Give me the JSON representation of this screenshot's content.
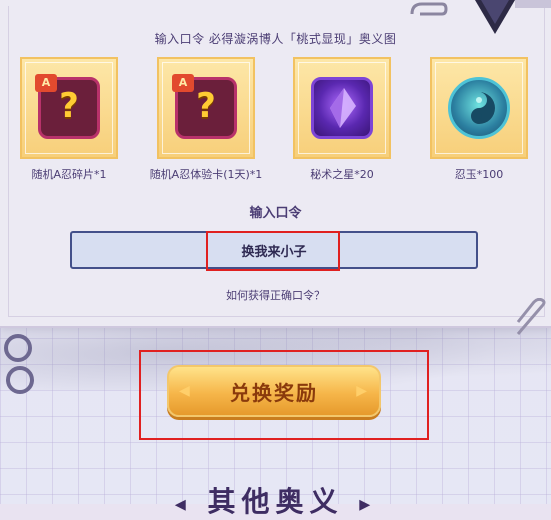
{
  "panel": {
    "headline": "输入口令 必得漩涡博人「桃式显现」奥义图"
  },
  "rewards": [
    {
      "label": "随机A忍碎片*1",
      "icon": "mystery-shard-icon",
      "badge": "A"
    },
    {
      "label": "随机A忍体验卡(1天)*1",
      "icon": "mystery-card-icon",
      "badge": "A"
    },
    {
      "label": "秘术之星*20",
      "icon": "crystal-star-icon"
    },
    {
      "label": "忍玉*100",
      "icon": "jade-orb-icon"
    }
  ],
  "code": {
    "label": "输入口令",
    "value": "换我来小子",
    "help": "如何获得正确口令？"
  },
  "redeem": {
    "label": "兑换奖励"
  },
  "section": {
    "title": "其他奥义"
  },
  "colors": {
    "highlight": "#e02020",
    "accent_text": "#4b3d74",
    "button_gold": "#f6b64a"
  }
}
